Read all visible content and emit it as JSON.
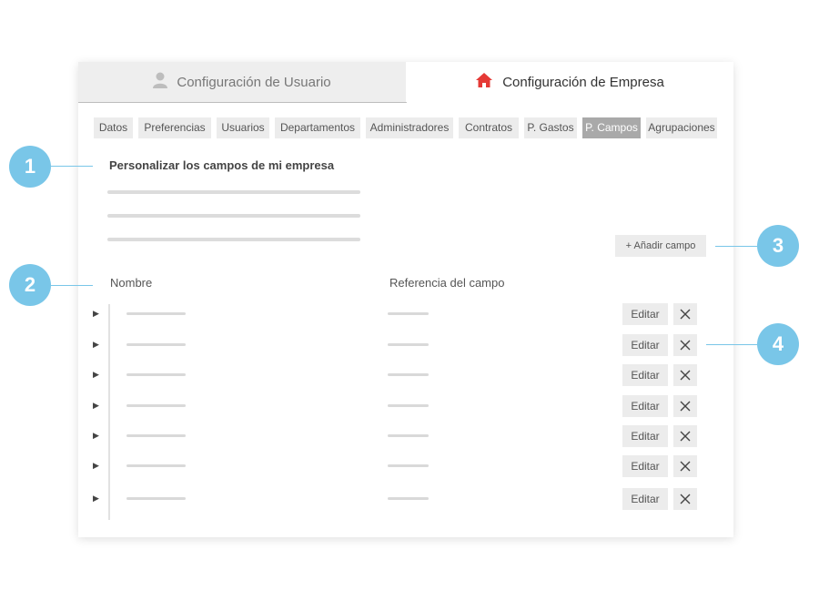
{
  "tabs": {
    "user": {
      "label": "Configuración de Usuario",
      "icon": "user-icon"
    },
    "company": {
      "label": "Configuración de Empresa",
      "icon": "home-icon"
    }
  },
  "subnav": {
    "items": [
      "Datos",
      "Preferencias",
      "Usuarios",
      "Departamentos",
      "Administradores",
      "Contratos",
      "P. Gastos",
      "P. Campos",
      "Agrupaciones"
    ],
    "active": "P. Campos"
  },
  "section": {
    "title": "Personalizar los campos de mi empresa"
  },
  "add_button": {
    "label": "+ Añadir campo"
  },
  "table": {
    "headers": {
      "name": "Nombre",
      "reference": "Referencia del campo"
    },
    "rows": [
      {
        "edit": "Editar"
      },
      {
        "edit": "Editar"
      },
      {
        "edit": "Editar"
      },
      {
        "edit": "Editar"
      },
      {
        "edit": "Editar"
      },
      {
        "edit": "Editar"
      },
      {
        "edit": "Editar"
      }
    ]
  },
  "callouts": [
    "1",
    "2",
    "3",
    "4"
  ],
  "colors": {
    "accent": "#79c6e8",
    "home_icon": "#e53935",
    "active_subtab": "#a9a9a9"
  }
}
